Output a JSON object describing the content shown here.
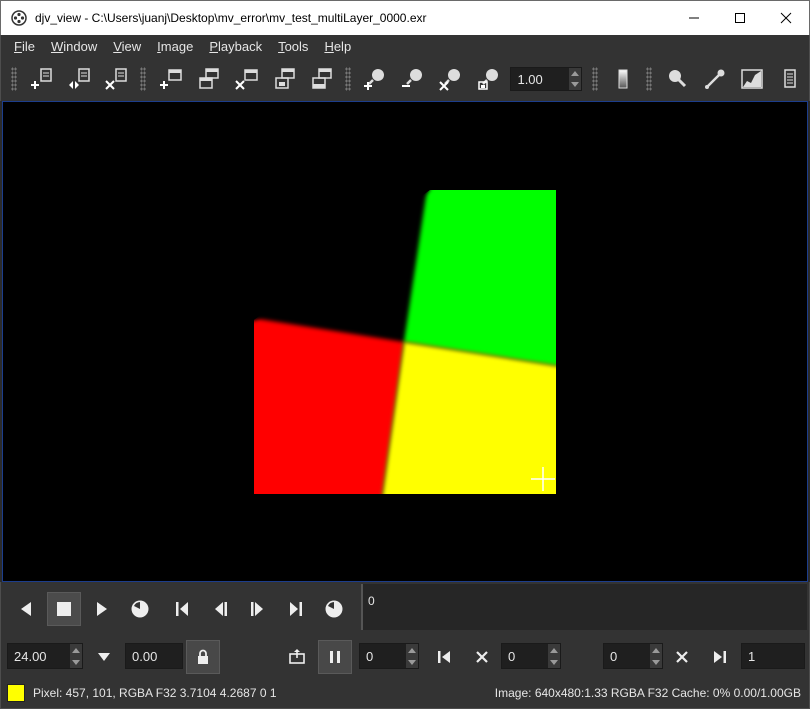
{
  "window": {
    "title": "djv_view - C:\\Users\\juanj\\Desktop\\mv_error\\mv_test_multiLayer_0000.exr",
    "controls": [
      "minimize-icon",
      "maximize-icon",
      "close-icon"
    ]
  },
  "menu": {
    "items": [
      {
        "key": "F",
        "rest": "ile"
      },
      {
        "key": "W",
        "rest": "indow"
      },
      {
        "key": "V",
        "rest": "iew"
      },
      {
        "key": "I",
        "rest": "mage"
      },
      {
        "key": "P",
        "rest": "layback"
      },
      {
        "key": "T",
        "rest": "ools"
      },
      {
        "key": "H",
        "rest": "elp"
      }
    ]
  },
  "toolbar": {
    "zoom_value": "1.00",
    "icons": [
      "file-open-icon",
      "file-reload-icon",
      "file-close-icon",
      "window-new-icon",
      "window-copy-icon",
      "window-close-icon",
      "window-fit-icon",
      "window-fullscreen-icon",
      "zoom-in-icon",
      "zoom-out-icon",
      "zoom-reset-icon",
      "zoom-fit-icon",
      "color-picker-icon",
      "magnify-icon",
      "color-picker-tool-icon",
      "histogram-icon",
      "info-icon"
    ]
  },
  "viewer": {
    "background": "#000000",
    "colors": {
      "red": "#ff0000",
      "green": "#00ff00",
      "yellow": "#ffff00"
    }
  },
  "playback": {
    "timeline_frame": "0",
    "icons": [
      "reverse-play-icon",
      "stop-icon",
      "forward-play-icon",
      "loop-icon",
      "start-frame-icon",
      "previous-frame-icon",
      "next-frame-icon",
      "end-frame-icon",
      "every-frame-icon"
    ]
  },
  "controls": {
    "speed": "24.00",
    "actual_speed": "0.00",
    "in_point": "0",
    "current_frame": "0",
    "out_point": "0",
    "duration": "1"
  },
  "status": {
    "swatch_color": "#ffff00",
    "pixel": "Pixel: 457, 101, RGBA F32 3.7104 4.2687 0 1",
    "image": "Image: 640x480:1.33 RGBA F32  Cache: 0% 0.00/1.00GB"
  }
}
